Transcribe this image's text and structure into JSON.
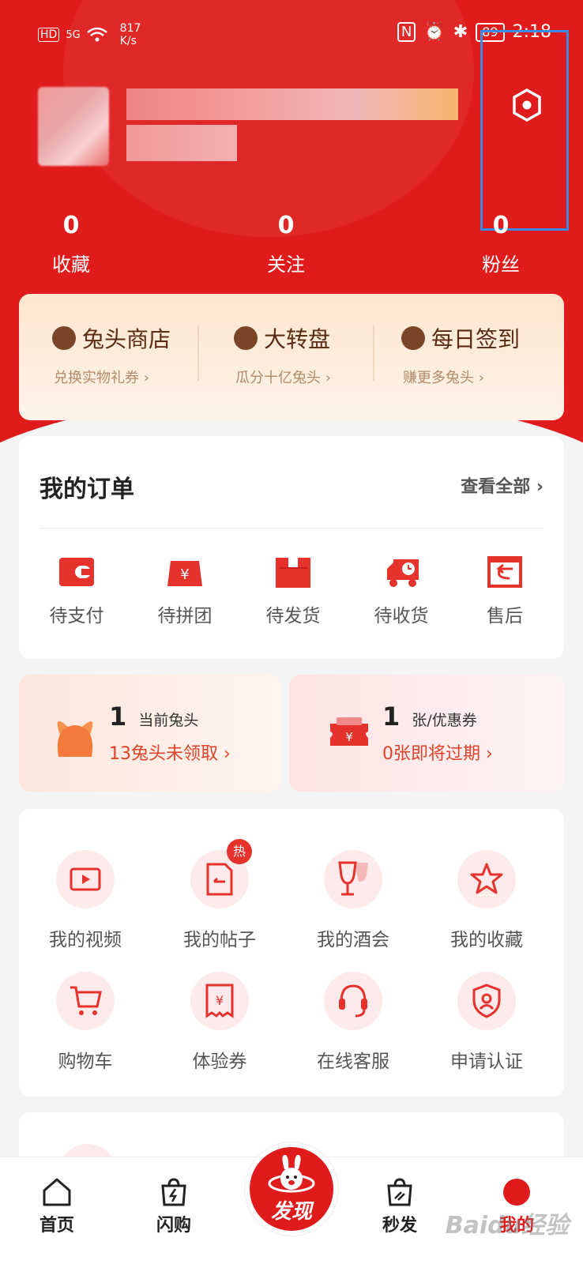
{
  "status_bar": {
    "left_icons": [
      "HD",
      "5G",
      "wifi"
    ],
    "net_speed": "817\nK/s",
    "battery": "89",
    "time": "2:18"
  },
  "header": {
    "settings_icon": "settings-icon",
    "stats": [
      {
        "value": "0",
        "label": "收藏"
      },
      {
        "value": "0",
        "label": "关注"
      },
      {
        "value": "0",
        "label": "粉丝"
      }
    ]
  },
  "shortcuts": [
    {
      "title": "兔头商店",
      "desc": "兑换实物礼券 ›",
      "icon": "rabbit-icon"
    },
    {
      "title": "大转盘",
      "desc": "瓜分十亿兔头 ›",
      "icon": "target-icon"
    },
    {
      "title": "每日签到",
      "desc": "赚更多兔头 ›",
      "icon": "calendar-check-icon"
    }
  ],
  "orders": {
    "title": "我的订单",
    "view_all": "查看全部 ›",
    "items": [
      {
        "label": "待支付",
        "icon": "wallet-icon"
      },
      {
        "label": "待拼团",
        "icon": "group-buy-icon"
      },
      {
        "label": "待发货",
        "icon": "box-icon"
      },
      {
        "label": "待收货",
        "icon": "truck-icon"
      },
      {
        "label": "售后",
        "icon": "return-icon"
      }
    ]
  },
  "coupons": [
    {
      "value": "1",
      "unit": "当前兔头",
      "sub": "13兔头未领取 ›"
    },
    {
      "value": "1",
      "unit": "张/优惠券",
      "sub": "0张即将过期 ›"
    }
  ],
  "tools": [
    {
      "label": "我的视频",
      "icon": "video-icon"
    },
    {
      "label": "我的帖子",
      "icon": "post-icon",
      "badge": "热"
    },
    {
      "label": "我的酒会",
      "icon": "wine-glass-icon"
    },
    {
      "label": "我的收藏",
      "icon": "star-icon"
    },
    {
      "label": "购物车",
      "icon": "cart-icon"
    },
    {
      "label": "体验券",
      "icon": "voucher-icon"
    },
    {
      "label": "在线客服",
      "icon": "headset-icon"
    },
    {
      "label": "申请认证",
      "icon": "shield-user-icon"
    }
  ],
  "tabbar": {
    "items": [
      {
        "label": "首页",
        "icon": "home-icon"
      },
      {
        "label": "闪购",
        "icon": "flash-bag-icon"
      },
      {
        "label": "发现",
        "icon": "rabbit-logo-icon"
      },
      {
        "label": "秒发",
        "icon": "fast-bag-icon"
      },
      {
        "label": "我的",
        "icon": "profile-icon"
      }
    ]
  },
  "colors": {
    "brand_red": "#e01b1b",
    "accent_orange": "#e0422b",
    "highlight_blue": "#3b8be6"
  }
}
